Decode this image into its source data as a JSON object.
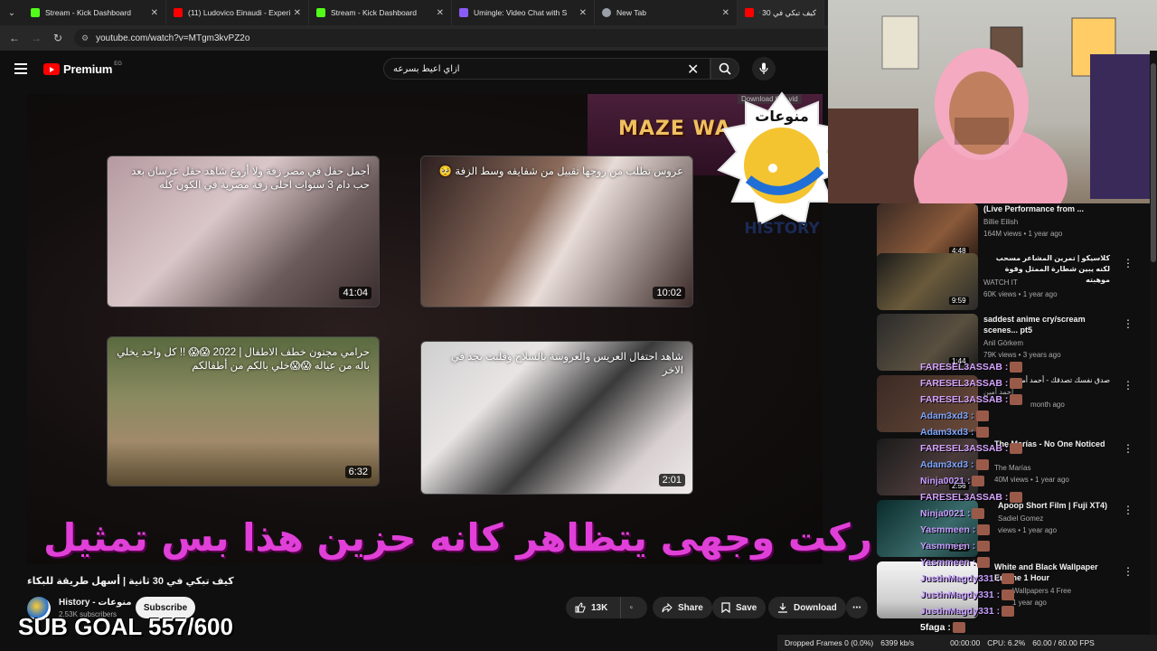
{
  "browser": {
    "tabs": [
      {
        "label": "Stream - Kick Dashboard",
        "favicon_color": "#53fc18"
      },
      {
        "label": "(11) Ludovico Einaudi - Experie",
        "favicon_color": "#ff0000"
      },
      {
        "label": "Stream - Kick Dashboard",
        "favicon_color": "#53fc18"
      },
      {
        "label": "Umingle: Video Chat with S",
        "favicon_color": "#8a5cf6"
      },
      {
        "label": "New Tab",
        "favicon_color": "#9aa0a6"
      },
      {
        "label": "كيف تبكي في 30 ثانية",
        "favicon_color": "#ff0000"
      }
    ],
    "url": "youtube.com/watch?v=MTgm3kvPZ2o"
  },
  "youtube": {
    "logo_text": "Premium",
    "country_code": "EG",
    "search_query": "ازاي اعيط بسرعه"
  },
  "player": {
    "ad_text": "MAZE WA",
    "download_hint": "Download this vid",
    "end_cards": [
      {
        "title": "أجمل حفل في مصر زفة ولا أروع شاهد حفل عرسان بعد حب دام 3 سنوات احلى زفة مصرية في الكون كله",
        "duration": "41:04"
      },
      {
        "title": "عروس تطلب من زوجها تقبيل من شفايفه وسط الزفة 🥺",
        "duration": "10:02"
      },
      {
        "title": "حرامي مجنون خطف الاطفال | 2022 😱😱 !! كل واحد يخلي باله من عياله 😱😱خلي بالكم من أطفالكم",
        "duration": "6:32"
      },
      {
        "title": "شاهد احتفال العريس والعروسة بالسلاح وقلبت بجد في الاخر",
        "duration": "2:01"
      }
    ],
    "overlay_text": "ركت وجهى يتظاهر كانه حزين هذا بس تمثيل",
    "badge_text_top": "منوعات",
    "badge_text_bottom": "HISTORY"
  },
  "video": {
    "title": "كيف تبكي في 30 ثانية | أسهل طريقة للبكاء",
    "channel_name": "History - منوعات",
    "subscribers": "2.53K subscribers",
    "subscribe_label": "Subscribe",
    "likes": "13K",
    "share_label": "Share",
    "save_label": "Save",
    "download_label": "Download"
  },
  "stream_overlay": {
    "sub_goal": "SUB GOAL 557/600"
  },
  "recommendations": [
    {
      "title": "(Live Performance from ...",
      "channel": "Billie Eilish",
      "meta": "164M views • 1 year ago",
      "duration": "4:48"
    },
    {
      "title": "كلاسيكو | تمرين المشاعر مسحب لكنه يبين شطارة الممثل وقوة موهبته",
      "channel": "WATCH IT",
      "meta": "60K views • 1 year ago",
      "duration": "9:59"
    },
    {
      "title": "saddest anime cry/scream scenes... pt5",
      "channel": "Anil Görkem",
      "meta": "79K views • 3 years ago",
      "duration": "1:44"
    },
    {
      "title": "صدق نفسك تصدقك - أحمد أمين",
      "channel": "أحمد أمين",
      "meta": "month ago",
      "duration": ""
    },
    {
      "title": "The Marías - No One Noticed",
      "channel": "The Marías",
      "meta": "40M views • 1 year ago",
      "duration": "2:56"
    },
    {
      "title": "Apoop Short Film | Fuji XT4)",
      "channel": "Sadiel Gomez",
      "meta": "views • 1 year ago",
      "duration": "5:18"
    },
    {
      "title": "White and Black Wallpaper Engine 1 Hour",
      "channel": "Wallpapers 4 Free",
      "meta": "1 year ago",
      "duration": ""
    }
  ],
  "chat": [
    {
      "user": "FARESEL3ASSAB :",
      "color": "#d6a4ff"
    },
    {
      "user": "FARESEL3ASSAB :",
      "color": "#d6a4ff"
    },
    {
      "user": "FARESEL3ASSAB :",
      "color": "#d6a4ff"
    },
    {
      "user": "Adam3xd3 :",
      "color": "#7ea6ff"
    },
    {
      "user": "Adam3xd3 :",
      "color": "#7ea6ff"
    },
    {
      "user": "FARESEL3ASSAB :",
      "color": "#d6a4ff"
    },
    {
      "user": "Adam3xd3 :",
      "color": "#7ea6ff"
    },
    {
      "user": "Ninja0021 :",
      "color": "#c59cff"
    },
    {
      "user": "FARESEL3ASSAB :",
      "color": "#d6a4ff"
    },
    {
      "user": "Ninja0021 :",
      "color": "#c59cff"
    },
    {
      "user": "Yasmmeen :",
      "color": "#c59cff"
    },
    {
      "user": "Yasmmeen :",
      "color": "#c59cff"
    },
    {
      "user": "Yasmmeen :",
      "color": "#c59cff"
    },
    {
      "user": "JustinMagdy331 :",
      "color": "#c59cff"
    },
    {
      "user": "JustinMagdy331 :",
      "color": "#c59cff"
    },
    {
      "user": "JustinMagdy331 :",
      "color": "#c59cff"
    },
    {
      "user": "5faga :",
      "color": "#ffffff"
    }
  ],
  "obs_status": {
    "dropped_frames": "Dropped Frames 0 (0.0%)",
    "bitrate": "6399 kb/s",
    "time": "00:00:00",
    "cpu": "CPU: 6.2%",
    "fps": "60.00 / 60.00 FPS"
  }
}
